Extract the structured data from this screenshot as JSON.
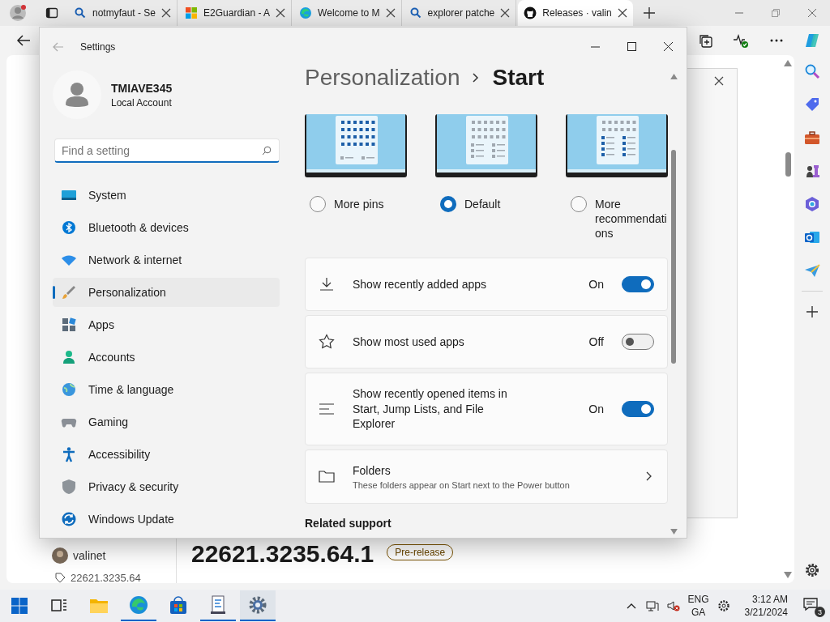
{
  "browser": {
    "tabs": [
      {
        "kind": "search",
        "title": "notmyfaut - Se",
        "selected": false
      },
      {
        "kind": "windows",
        "title": "E2Guardian - A",
        "selected": false
      },
      {
        "kind": "edge",
        "title": "Welcome to M",
        "selected": false
      },
      {
        "kind": "search",
        "title": "explorer patche",
        "selected": false
      },
      {
        "kind": "github",
        "title": "Releases · valin",
        "selected": true
      }
    ]
  },
  "page": {
    "release_version": "22621.3235.64.1",
    "badge": "Pre-release",
    "author": "valinet",
    "tag": "22621.3235.64"
  },
  "settings": {
    "title": "Settings",
    "user": {
      "name": "TMIAVE345",
      "account": "Local Account"
    },
    "search": {
      "placeholder": "Find a setting"
    },
    "nav": [
      {
        "kind": "system",
        "label": "System",
        "selected": false
      },
      {
        "kind": "bluetooth",
        "label": "Bluetooth & devices",
        "selected": false
      },
      {
        "kind": "network",
        "label": "Network & internet",
        "selected": false
      },
      {
        "kind": "personalization",
        "label": "Personalization",
        "selected": true
      },
      {
        "kind": "apps",
        "label": "Apps",
        "selected": false
      },
      {
        "kind": "accounts",
        "label": "Accounts",
        "selected": false
      },
      {
        "kind": "time",
        "label": "Time & language",
        "selected": false
      },
      {
        "kind": "gaming",
        "label": "Gaming",
        "selected": false
      },
      {
        "kind": "accessibility",
        "label": "Accessibility",
        "selected": false
      },
      {
        "kind": "privacy",
        "label": "Privacy & security",
        "selected": false
      },
      {
        "kind": "update",
        "label": "Windows Update",
        "selected": false
      }
    ],
    "breadcrumb": [
      "Personalization",
      "Start"
    ],
    "layouts": [
      {
        "kind": "pins",
        "label": "More pins",
        "selected": false
      },
      {
        "kind": "default",
        "label": "Default",
        "selected": true
      },
      {
        "kind": "recommendations",
        "label": "More recommendations",
        "selected": false
      }
    ],
    "options": [
      {
        "kind": "toggle",
        "label": "Show recently added apps",
        "state_label": "On",
        "on": true
      },
      {
        "kind": "toggle",
        "label": "Show most used apps",
        "state_label": "Off",
        "on": false
      },
      {
        "kind": "toggle",
        "label": "Show recently opened items in Start, Jump Lists, and File Explorer",
        "state_label": "On",
        "on": true
      },
      {
        "kind": "link",
        "label": "Folders",
        "description": "These folders appear on Start next to the Power button"
      }
    ],
    "section_heading": "Related support"
  },
  "taskbar": {
    "apps": [
      {
        "kind": "start",
        "running": false,
        "selected": false
      },
      {
        "kind": "taskview",
        "running": false,
        "selected": false
      },
      {
        "kind": "explorer",
        "running": false,
        "selected": false
      },
      {
        "kind": "edge",
        "running": true,
        "selected": false
      },
      {
        "kind": "store",
        "running": false,
        "selected": false
      },
      {
        "kind": "notepad",
        "running": true,
        "selected": false
      },
      {
        "kind": "settings",
        "running": true,
        "selected": true
      }
    ],
    "tray": {
      "language": "ENG",
      "layout": "GA",
      "time": "3:12 AM",
      "date": "3/21/2024",
      "notifications": "3"
    }
  }
}
